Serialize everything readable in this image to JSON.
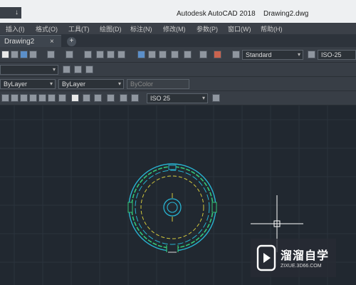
{
  "titlebar": {
    "qat_label": "↓",
    "app_title": "Autodesk AutoCAD 2018",
    "doc_title": "Drawing2.dwg"
  },
  "menu": {
    "items": [
      "插入(I)",
      "格式(O)",
      "工具(T)",
      "绘图(D)",
      "标注(N)",
      "修改(M)",
      "参数(P)",
      "窗口(W)",
      "帮助(H)"
    ]
  },
  "tabs": {
    "active": "Drawing2",
    "close_glyph": "×",
    "new_glyph": "+"
  },
  "toolbar": {
    "text_style": "Standard",
    "dim_style": "ISO-25",
    "layer_color": "ByLayer",
    "layer_linetype": "ByLayer",
    "layer_lineweight": "ByColor",
    "dim_style_2": "ISO 25"
  },
  "watermark": {
    "text": "溜溜自学",
    "url": "ZIXUE.3D66.COM"
  },
  "colors": {
    "canvas": "#212830",
    "drawing_green": "#32c878",
    "drawing_cyan": "#28b4d2",
    "drawing_yellow": "#d2c83c",
    "crosshair": "#ffffff"
  }
}
